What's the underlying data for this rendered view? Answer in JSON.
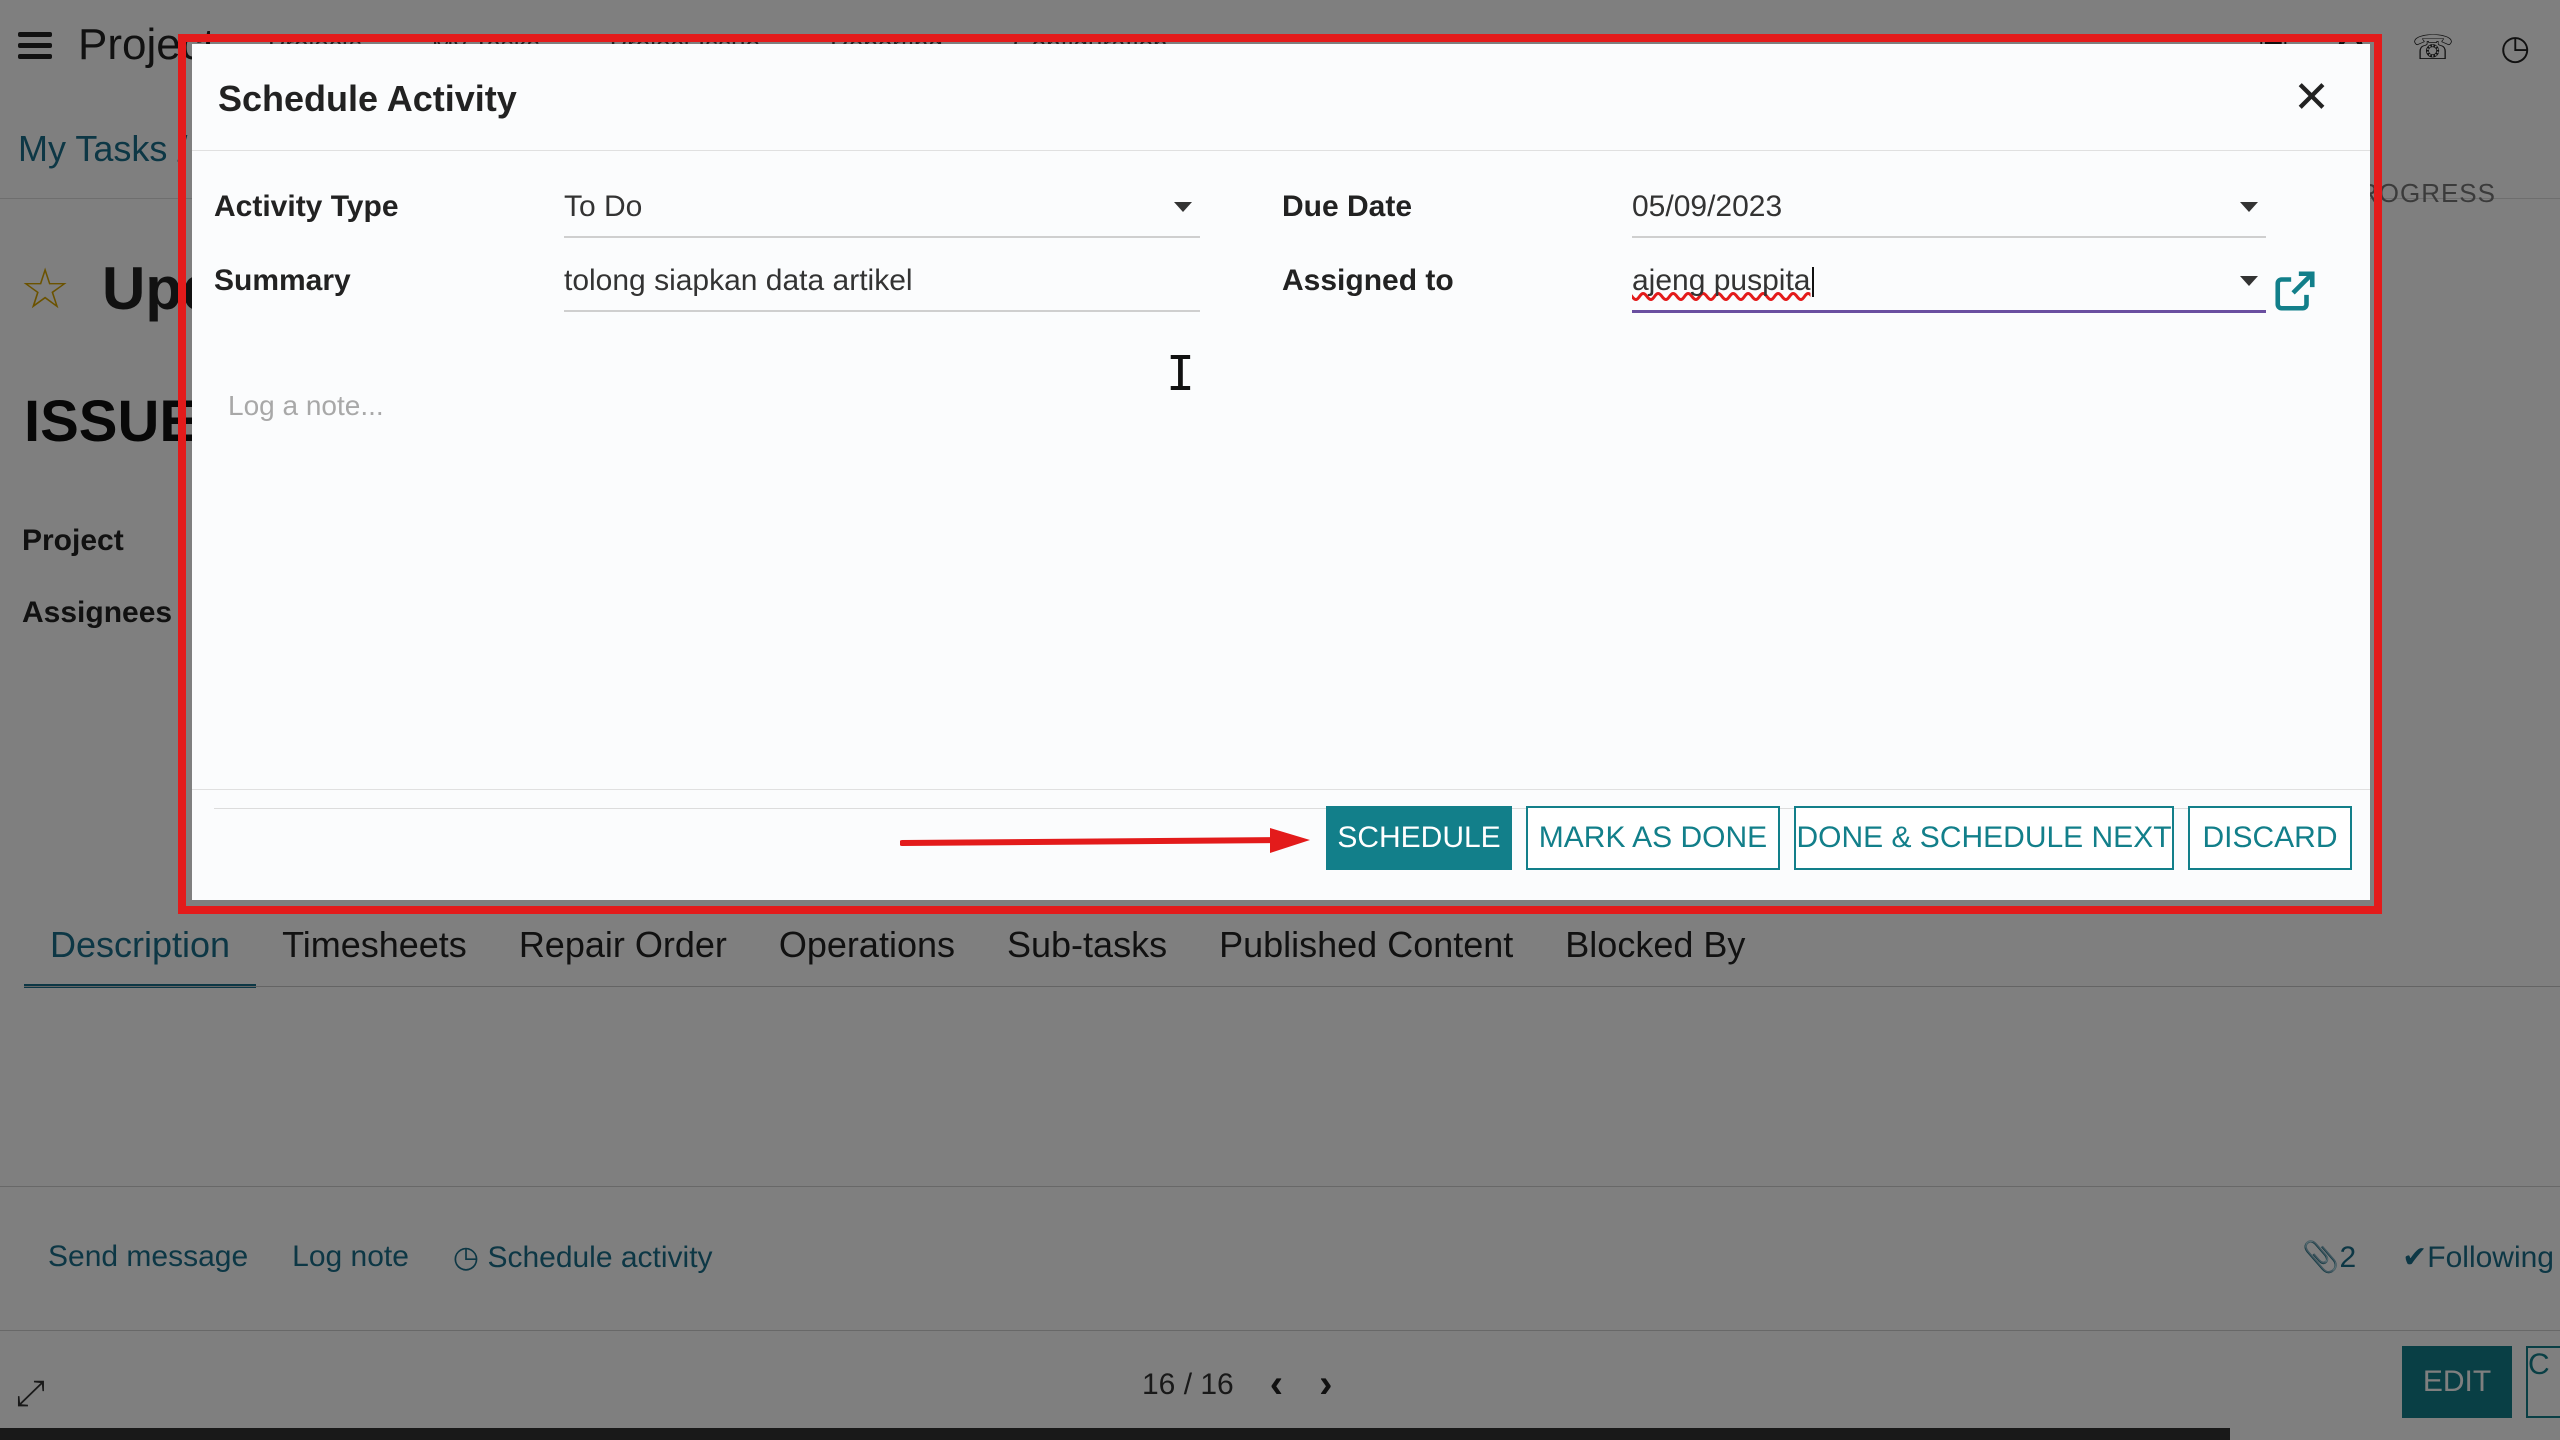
{
  "background": {
    "app_name": "Project",
    "nav_menu": [
      "Projects",
      "My Tasks",
      "Project Issue",
      "Reporting",
      "Configuration"
    ],
    "breadcrumb": "My Tasks /",
    "status_hint": "PROGRESS",
    "record_title": "Upd",
    "issue_title": "ISSUE",
    "labels": {
      "project": "Project",
      "assignees": "Assignees"
    },
    "tabs": [
      "Description",
      "Timesheets",
      "Repair Order",
      "Operations",
      "Sub-tasks",
      "Published Content",
      "Blocked By"
    ],
    "active_tab": "Description",
    "chatter": {
      "send_message": "Send message",
      "log_note": "Log note",
      "schedule_activity": "Schedule activity",
      "attachments_count": "2",
      "following": "Following"
    },
    "pager": {
      "text": "16 / 16"
    },
    "edit_label": "EDIT",
    "create_label": "C"
  },
  "modal": {
    "title": "Schedule Activity",
    "fields": {
      "activity_type": {
        "label": "Activity Type",
        "value": "To Do"
      },
      "summary": {
        "label": "Summary",
        "value": "tolong siapkan data artikel"
      },
      "due_date": {
        "label": "Due Date",
        "value": "05/09/2023"
      },
      "assigned_to": {
        "label": "Assigned to",
        "value": "ajeng puspita"
      }
    },
    "note_placeholder": "Log a note...",
    "buttons": {
      "schedule": "SCHEDULE",
      "mark_as_done": "MARK AS DONE",
      "done_schedule_next": "DONE & SCHEDULE NEXT",
      "discard": "DISCARD"
    }
  },
  "colors": {
    "accent": "#127f8a",
    "highlight": "#e31b1b",
    "overlay": "rgba(0,0,0,0.5)"
  }
}
